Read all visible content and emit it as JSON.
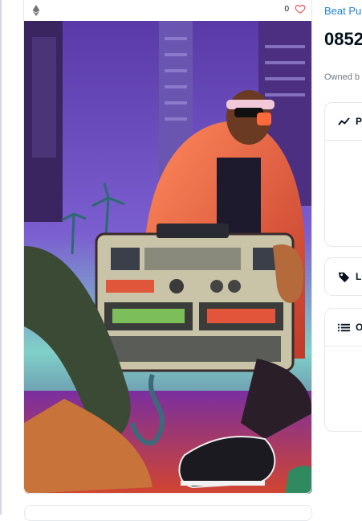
{
  "card": {
    "chain_icon": "ethereum-icon",
    "favorite_count": "0",
    "favorite_icon": "heart-icon"
  },
  "info": {
    "collection": "Beat Pur",
    "title": "0852",
    "owned_by": "Owned b"
  },
  "panels": [
    {
      "icon": "trend-line-icon",
      "label": "P"
    },
    {
      "icon": "tag-icon",
      "label": "Li"
    },
    {
      "icon": "list-icon",
      "label": "O"
    }
  ],
  "colors": {
    "accent": "#2081e2",
    "heart": "#eb5757",
    "border": "#e5e8eb"
  }
}
